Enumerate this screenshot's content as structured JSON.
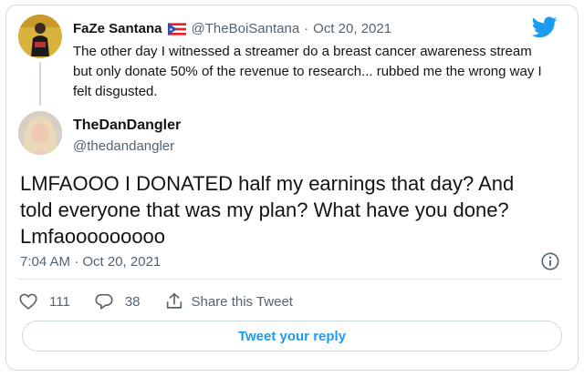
{
  "parent_tweet": {
    "display_name": "FaZe Santana",
    "handle": "@TheBoiSantana",
    "separator": "·",
    "date": "Oct 20, 2021",
    "text": "The other day I witnessed a streamer do a breast cancer awareness stream but only donate 50% of the revenue to research... rubbed me the wrong way I felt disgusted."
  },
  "main_tweet": {
    "display_name": "TheDanDangler",
    "handle": "@thedandangler",
    "text": "LMFAOOO I DONATED half my earnings that day? And told everyone that was my plan? What have you done? Lmfaooooooooo",
    "timestamp": "7:04 AM · Oct 20, 2021"
  },
  "actions": {
    "likes_count": "111",
    "replies_count": "38",
    "share_label": "Share this Tweet"
  },
  "reply_button_label": "Tweet your reply",
  "icons": {
    "brand": "twitter-bird-icon",
    "flag": "puerto-rico-flag-icon",
    "info": "info-icon",
    "like": "heart-icon",
    "reply": "speech-bubble-icon",
    "share": "share-icon"
  },
  "colors": {
    "accent": "#1d9bf0",
    "text": "#0f1419",
    "muted": "#536471",
    "border": "#cfd9de"
  }
}
